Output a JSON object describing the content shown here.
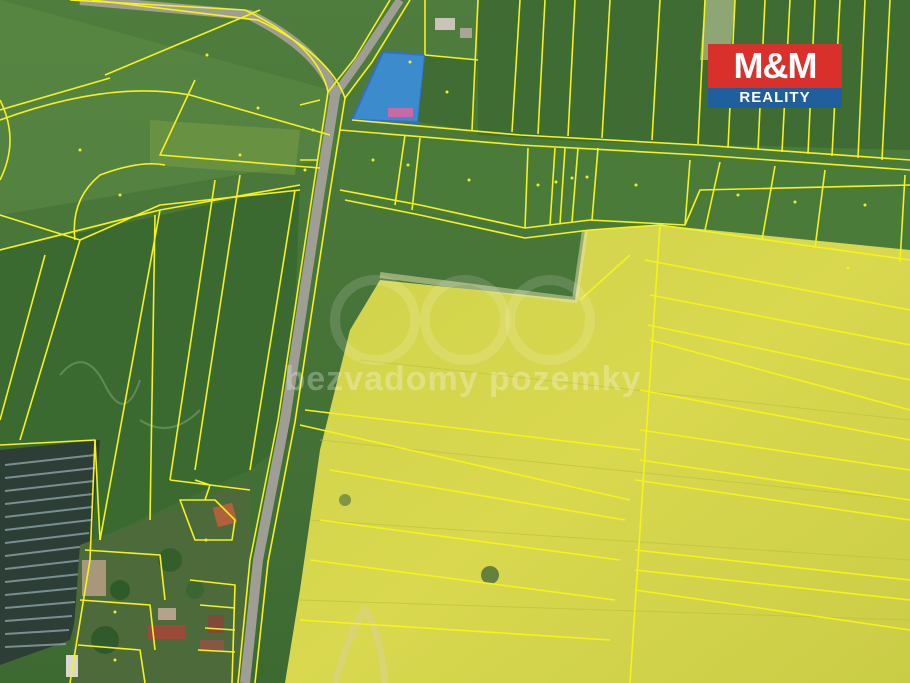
{
  "map": {
    "logo": {
      "top_text": "M&M",
      "bottom_text": "REALITY"
    },
    "watermark": "bezvadomy pozemky",
    "colors": {
      "boundary": "#f5f21c",
      "highlight_fill": "#3a8ee6",
      "highlight_border": "#2f6fd6",
      "logo_red": "#d9302b",
      "logo_blue": "#1f5f9e",
      "rapeseed": "#d5d548",
      "grass": "#4b7a3a"
    }
  }
}
